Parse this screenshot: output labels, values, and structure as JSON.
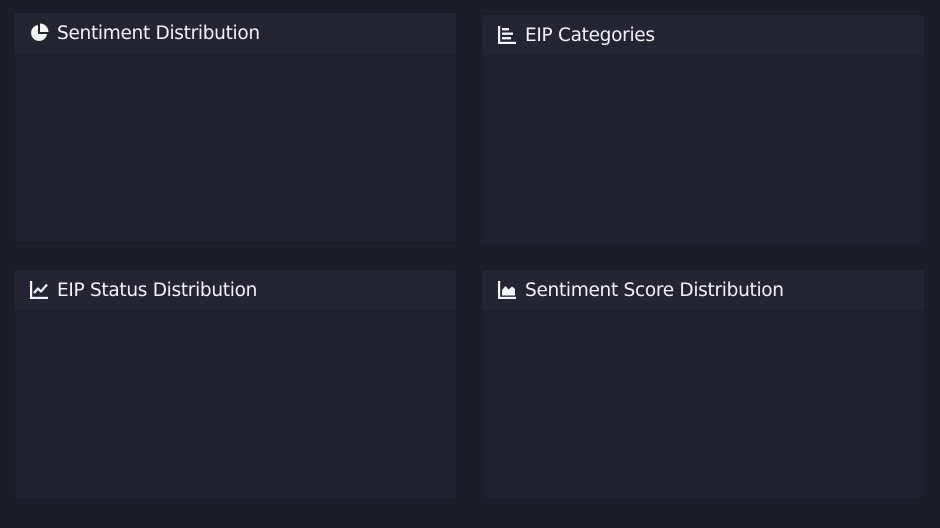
{
  "panels": [
    {
      "title": "Sentiment Distribution",
      "icon": "pie-chart-icon"
    },
    {
      "title": "EIP Categories",
      "icon": "bar-chart-icon"
    },
    {
      "title": "EIP Status Distribution",
      "icon": "line-chart-icon"
    },
    {
      "title": "Sentiment Score Distribution",
      "icon": "area-chart-icon"
    }
  ],
  "colors": {
    "background": "#191e27",
    "panel": "#1c212b",
    "panel_header": "#212630",
    "text": "#f2f4f7"
  }
}
